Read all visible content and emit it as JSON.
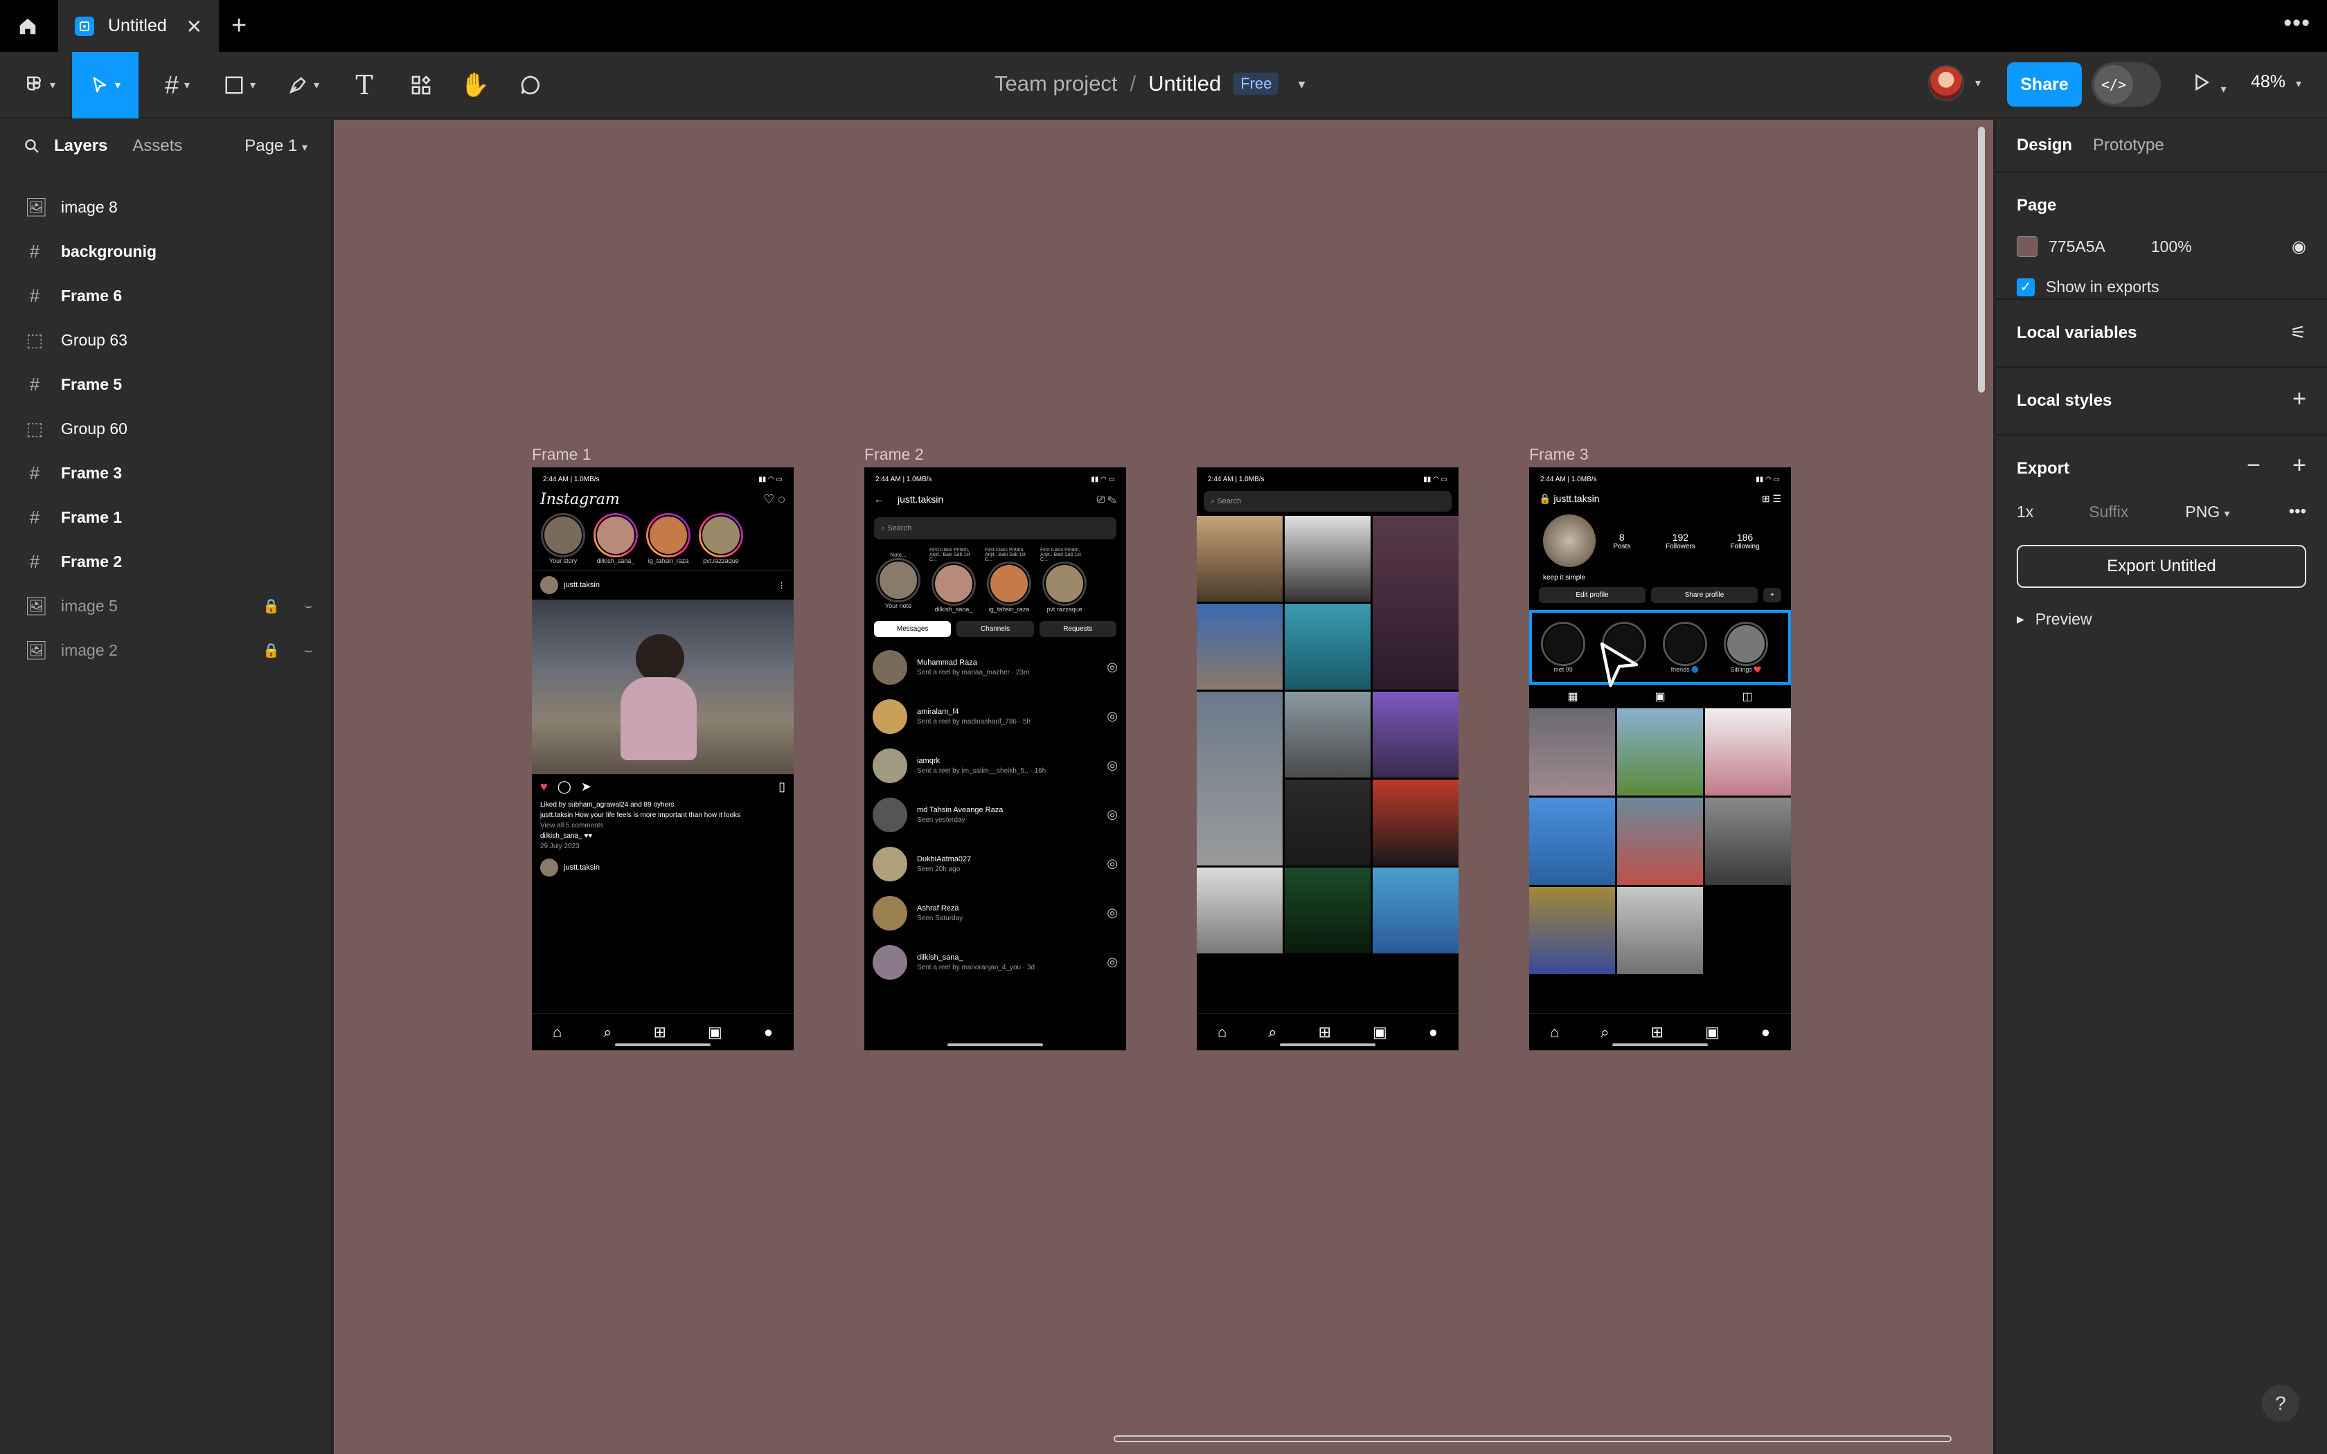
{
  "tab": {
    "title": "Untitled"
  },
  "breadcrumb": {
    "team": "Team project",
    "separator": "/",
    "file": "Untitled",
    "badge": "Free"
  },
  "toolbar": {
    "share_label": "Share",
    "zoom": "48%",
    "dev_mode_glyph": "</>"
  },
  "left_panel": {
    "tabs": {
      "layers": "Layers",
      "assets": "Assets"
    },
    "page_selector": "Page 1",
    "layers": [
      {
        "name": "image 8",
        "icon": "image-icon",
        "style": "normal"
      },
      {
        "name": "backgrounig",
        "icon": "frame-icon",
        "style": "bold"
      },
      {
        "name": "Frame 6",
        "icon": "frame-icon",
        "style": "bold"
      },
      {
        "name": "Group 63",
        "icon": "group-icon",
        "style": "normal"
      },
      {
        "name": "Frame 5",
        "icon": "frame-icon",
        "style": "bold"
      },
      {
        "name": "Group 60",
        "icon": "group-icon",
        "style": "normal"
      },
      {
        "name": "Frame 3",
        "icon": "frame-icon",
        "style": "bold"
      },
      {
        "name": "Frame 1",
        "icon": "frame-icon",
        "style": "bold"
      },
      {
        "name": "Frame 2",
        "icon": "frame-icon",
        "style": "bold"
      },
      {
        "name": "image 5",
        "icon": "image-icon",
        "style": "dim",
        "locked": true,
        "hidden": true
      },
      {
        "name": "image 2",
        "icon": "image-icon",
        "style": "dim",
        "locked": true,
        "hidden": true
      }
    ]
  },
  "canvas": {
    "background": "#775A5A",
    "frame_labels": [
      "Frame 1",
      "Frame 2",
      "Frame 3"
    ],
    "status_time": "2:44 AM | 1.0MB/s",
    "frame1": {
      "logo": "Instagram",
      "stories": [
        "Your story",
        "dilkish_sana_",
        "ig_tahsin_raza",
        "pvt.razzaque"
      ],
      "post_user": "justt.taksin",
      "liked_by": "Liked by subham_agrawal24 and 89 oyhers",
      "caption": "justt.taksin How your life feels is more important than how it looks",
      "view_comments": "View all 5 comments",
      "comment": "dilkish_sana_ ♥♥",
      "date": "29 July 2023",
      "post_user2": "justt.taksin"
    },
    "frame2": {
      "username": "justt.taksin",
      "search_placeholder": "Search",
      "notes": [
        "Your note",
        "dilkish_sana_",
        "ig_tahsin_raza",
        "pvt.razzaque"
      ],
      "note_texts": [
        "Note...",
        "First Class Pritam, Arijit.. Baki Sab 1st C...",
        "First Class Pritam, Arijit.. Baki Sab 1st C...",
        "First Class Pritam, Arijit.. Baki Sab 1st C..."
      ],
      "tabs": [
        "Messages",
        "Channels",
        "Requests"
      ],
      "messages": [
        {
          "name": "Muhammad Raza",
          "sub": "Sent a reel by mariaa_mazher · 23m"
        },
        {
          "name": "amiralam_f4",
          "sub": "Sent a reel by madinasharif_786 · 5h"
        },
        {
          "name": "iamqrk",
          "sub": "Sent a reel by im_saiim__sheikh_5.. · 16h"
        },
        {
          "name": "md Tahsin Aveange Raza",
          "sub": "Seen yesterday"
        },
        {
          "name": "DukhiAatma027",
          "sub": "Seen 20h ago"
        },
        {
          "name": "Ashraf Reza",
          "sub": "Seen Saturday"
        },
        {
          "name": "dilkish_sana_",
          "sub": "Sent a reel by manoranjan_4_you · 3d"
        }
      ]
    },
    "frame_explore": {
      "search_placeholder": "Search"
    },
    "frame3": {
      "username": "justt.taksin",
      "posts": "8",
      "posts_label": "Posts",
      "followers": "192",
      "followers_label": "Followers",
      "following": "186",
      "following_label": "Following",
      "bio": "keep it simple",
      "edit_profile": "Edit profile",
      "share_profile": "Share profile",
      "highlights": [
        "met 99",
        "friends 🔵",
        "Siblings ❤️"
      ]
    }
  },
  "right_panel": {
    "tabs": {
      "design": "Design",
      "prototype": "Prototype"
    },
    "page_title": "Page",
    "page_color": "775A5A",
    "page_opacity": "100%",
    "show_in_exports": "Show in exports",
    "local_variables": "Local variables",
    "local_styles": "Local styles",
    "export_title": "Export",
    "export_scale": "1x",
    "export_suffix_placeholder": "Suffix",
    "export_format": "PNG",
    "export_button": "Export Untitled",
    "preview": "Preview"
  },
  "colors": {
    "accent": "#0d99ff",
    "canvas": "#775a5a",
    "panel": "#2c2c2c"
  }
}
